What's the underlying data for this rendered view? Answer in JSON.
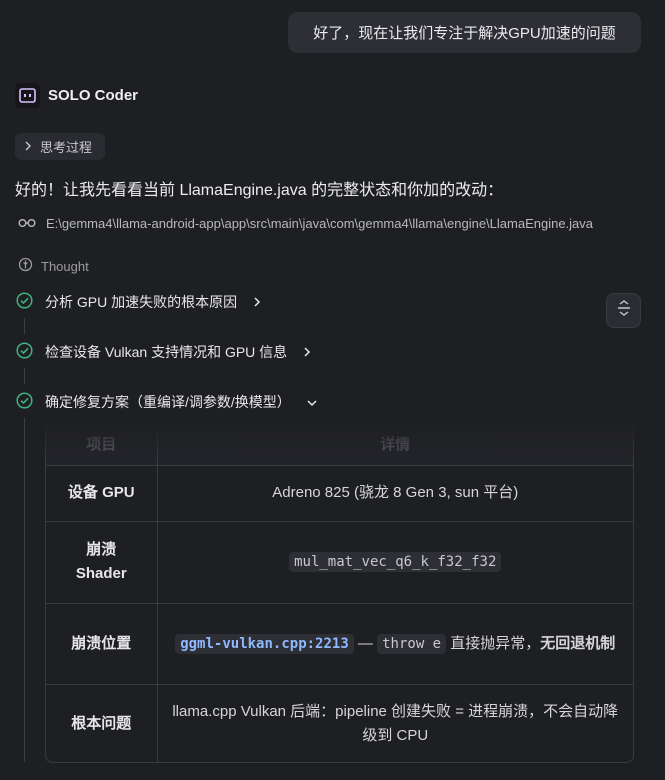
{
  "user_message": "好了，现在让我们专注于解决GPU加速的问题",
  "agent": {
    "name": "SOLO Coder"
  },
  "thinking_toggle_label": "思考过程",
  "intro_text": "好的！让我先看看当前 LlamaEngine.java 的完整状态和你加的改动：",
  "file_path": "E:\\gemma4\\llama-android-app\\app\\src\\main\\java\\com\\gemma4\\llama\\engine\\LlamaEngine.java",
  "thought_label": "Thought",
  "steps": [
    {
      "label": "分析 GPU 加速失败的根本原因",
      "status": "done",
      "expanded": false
    },
    {
      "label": "检查设备 Vulkan 支持情况和 GPU 信息",
      "status": "done",
      "expanded": false
    },
    {
      "label": "确定修复方案（重编译/调参数/换模型）",
      "status": "done",
      "expanded": true
    }
  ],
  "table": {
    "headers": [
      "项目",
      "详情"
    ],
    "rows": [
      {
        "item": "设备 GPU",
        "detail": "Adreno 825 (骁龙 8 Gen 3, sun 平台)"
      },
      {
        "item": "崩溃 Shader",
        "detail_code": "mul_mat_vec_q6_k_f32_f32"
      },
      {
        "item": "崩溃位置",
        "detail_link": "ggml-vulkan.cpp:2213",
        "detail_sep": " — ",
        "detail_code": "throw e",
        "detail_text": " 直接抛异常，",
        "detail_bold": "无回退机制"
      },
      {
        "item": "根本问题",
        "detail": "llama.cpp Vulkan 后端：pipeline 创建失败 = 进程崩溃，不会自动降级到 CPU"
      }
    ]
  },
  "colors": {
    "background": "#1e1f23",
    "success_green": "#3fb27f",
    "link_blue": "#8fb8ff"
  }
}
